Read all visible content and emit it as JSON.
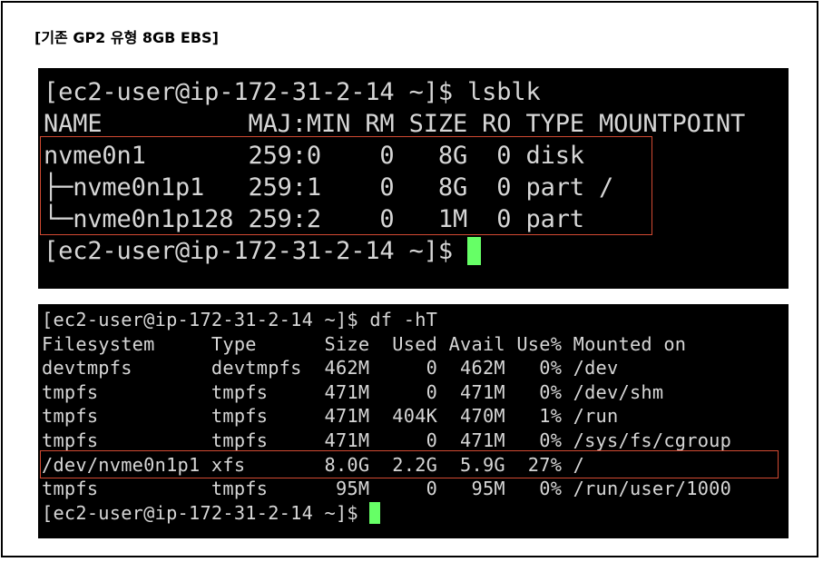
{
  "heading": "[기존 GP2 유형 8GB EBS]",
  "colors": {
    "cursor": "#66ff66",
    "highlight": "#d24a32",
    "terminal_bg": "#000000",
    "terminal_fg": "#d6d6d6"
  },
  "terminal1": {
    "lines": [
      "[ec2-user@ip-172-31-2-14 ~]$ lsblk",
      "NAME          MAJ:MIN RM SIZE RO TYPE MOUNTPOINT",
      "nvme0n1       259:0    0   8G  0 disk",
      "├─nvme0n1p1   259:1    0   8G  0 part /",
      "└─nvme0n1p128 259:2    0   1M  0 part"
    ],
    "prompt": "[ec2-user@ip-172-31-2-14 ~]$ "
  },
  "terminal2": {
    "lines": [
      "[ec2-user@ip-172-31-2-14 ~]$ df -hT",
      "Filesystem     Type      Size  Used Avail Use% Mounted on",
      "devtmpfs       devtmpfs  462M     0  462M   0% /dev",
      "tmpfs          tmpfs     471M     0  471M   0% /dev/shm",
      "tmpfs          tmpfs     471M  404K  470M   1% /run",
      "tmpfs          tmpfs     471M     0  471M   0% /sys/fs/cgroup",
      "/dev/nvme0n1p1 xfs       8.0G  2.2G  5.9G  27% /",
      "tmpfs          tmpfs      95M     0   95M   0% /run/user/1000"
    ],
    "prompt": "[ec2-user@ip-172-31-2-14 ~]$ "
  }
}
